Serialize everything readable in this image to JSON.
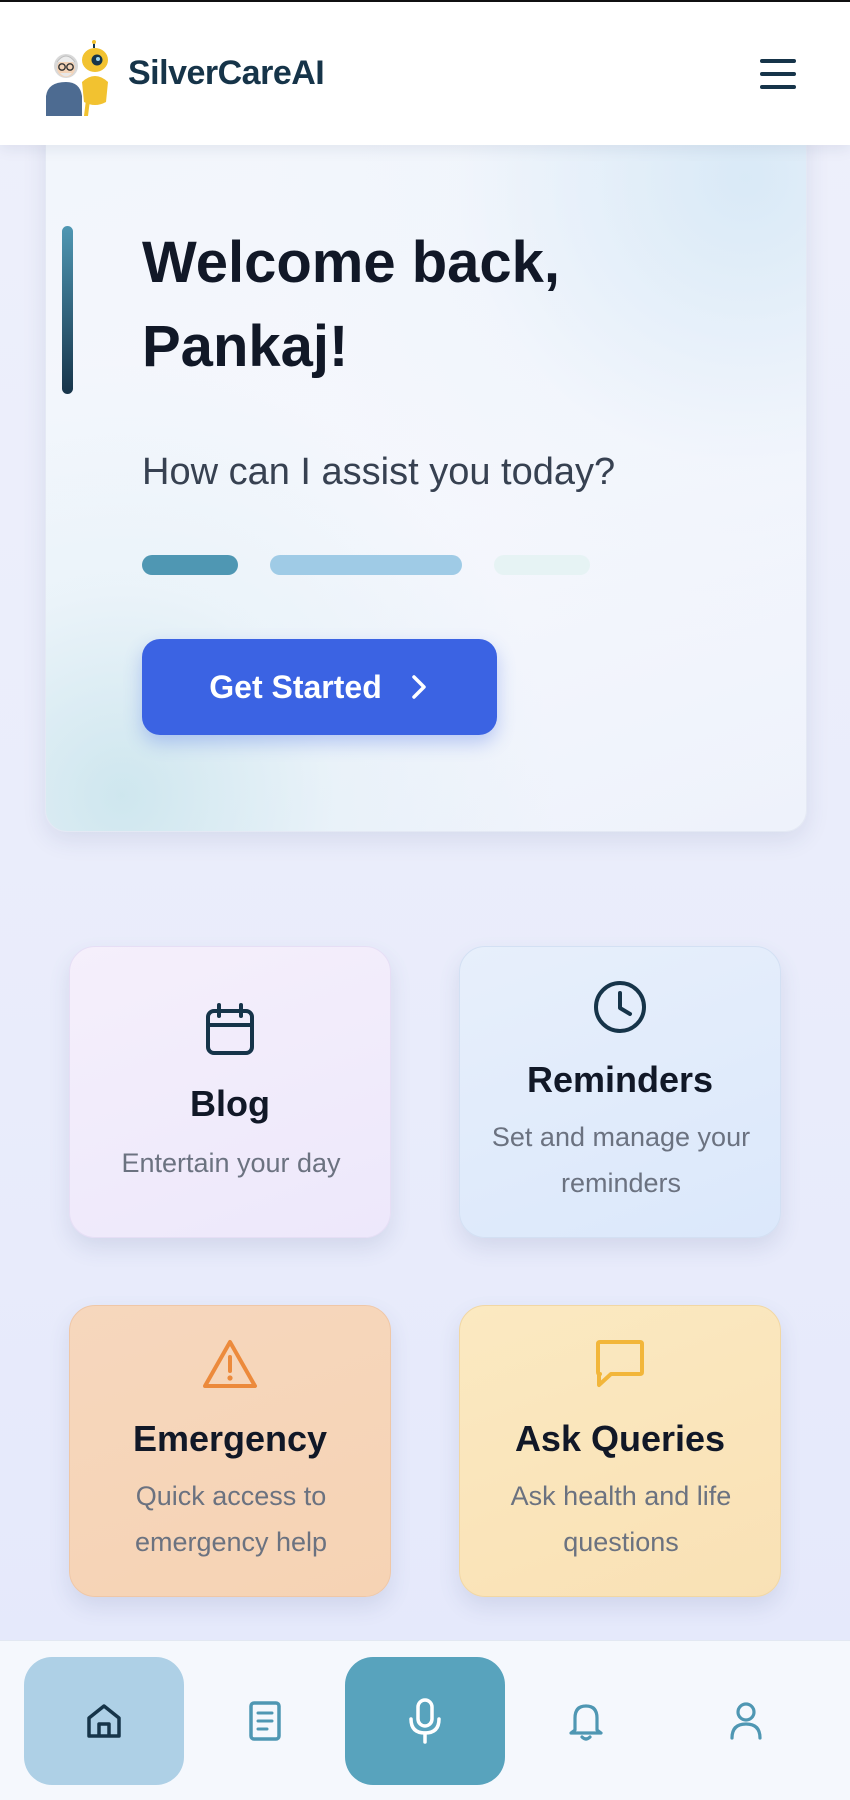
{
  "app": {
    "brand": "SilverCareAI"
  },
  "hero": {
    "welcome": "Welcome back, Pankaj!",
    "subtitle": "How can I assist you today?",
    "cta_label": "Get Started"
  },
  "cards": {
    "blog": {
      "title": "Blog",
      "description": "Entertain your day",
      "icon": "calendar-icon"
    },
    "reminders": {
      "title": "Reminders",
      "description": "Set and manage your reminders",
      "icon": "clock-icon"
    },
    "emergency": {
      "title": "Emergency",
      "description": "Quick access to emergency help",
      "icon": "warning-icon"
    },
    "queries": {
      "title": "Ask Queries",
      "description": "Ask health and life questions",
      "icon": "chat-icon"
    }
  },
  "nav": {
    "items": [
      "home-icon",
      "book-icon",
      "microphone-icon",
      "bell-icon",
      "user-icon"
    ],
    "active": "home-icon"
  },
  "colors": {
    "primary_button": "#3b63e3",
    "brand_text": "#163449",
    "nav_active": "#aed0e6",
    "mic_button": "#58a3bd",
    "progress_active": "#4f97b3",
    "progress_mid": "#9fcbe6",
    "progress_light": "#e6f3f4"
  }
}
